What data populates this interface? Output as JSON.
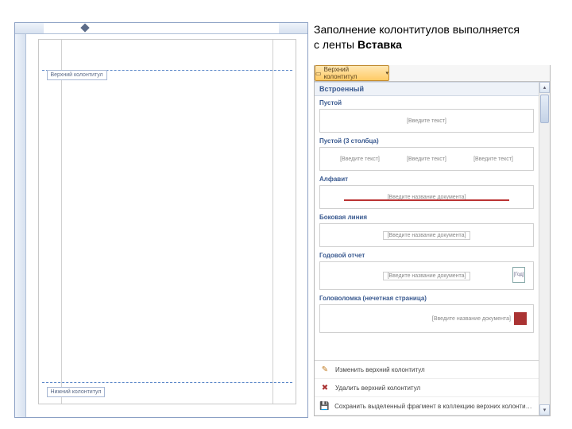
{
  "caption": {
    "line1_prefix": "Заполнение колонтитулов выполняется",
    "line2_prefix": "с ленты ",
    "bold": "Вставка"
  },
  "word_doc": {
    "header_tab": "Верхний колонтитул",
    "footer_tab": "Нижний колонтитул"
  },
  "dropdown": {
    "button_label": "Верхний колонтитул",
    "builtin_header": "Встроенный",
    "items": [
      {
        "title": "Пустой",
        "placeholders": [
          "[Введите текст]"
        ],
        "type": "single"
      },
      {
        "title": "Пустой (3 столбца)",
        "placeholders": [
          "[Введите текст]",
          "[Введите текст]",
          "[Введите текст]"
        ],
        "type": "three"
      },
      {
        "title": "Алфавит",
        "placeholders": [
          "[Введите название документа]"
        ],
        "type": "alpha"
      },
      {
        "title": "Боковая линия",
        "placeholders": [
          "[Введите название документа]"
        ],
        "type": "single"
      },
      {
        "title": "Годовой отчет",
        "placeholders": [
          "[Введите название документа]"
        ],
        "page_label": "[Год]",
        "type": "annual"
      },
      {
        "title": "Головоломка (нечетная страница)",
        "placeholders": [
          "[Введите название документа]"
        ],
        "type": "puzzle"
      }
    ],
    "footer_menu": {
      "edit": "Изменить верхний колонтитул",
      "remove": "Удалить верхний колонтитул",
      "save": "Сохранить выделенный фрагмент в коллекцию верхних колонтитулов..."
    }
  }
}
